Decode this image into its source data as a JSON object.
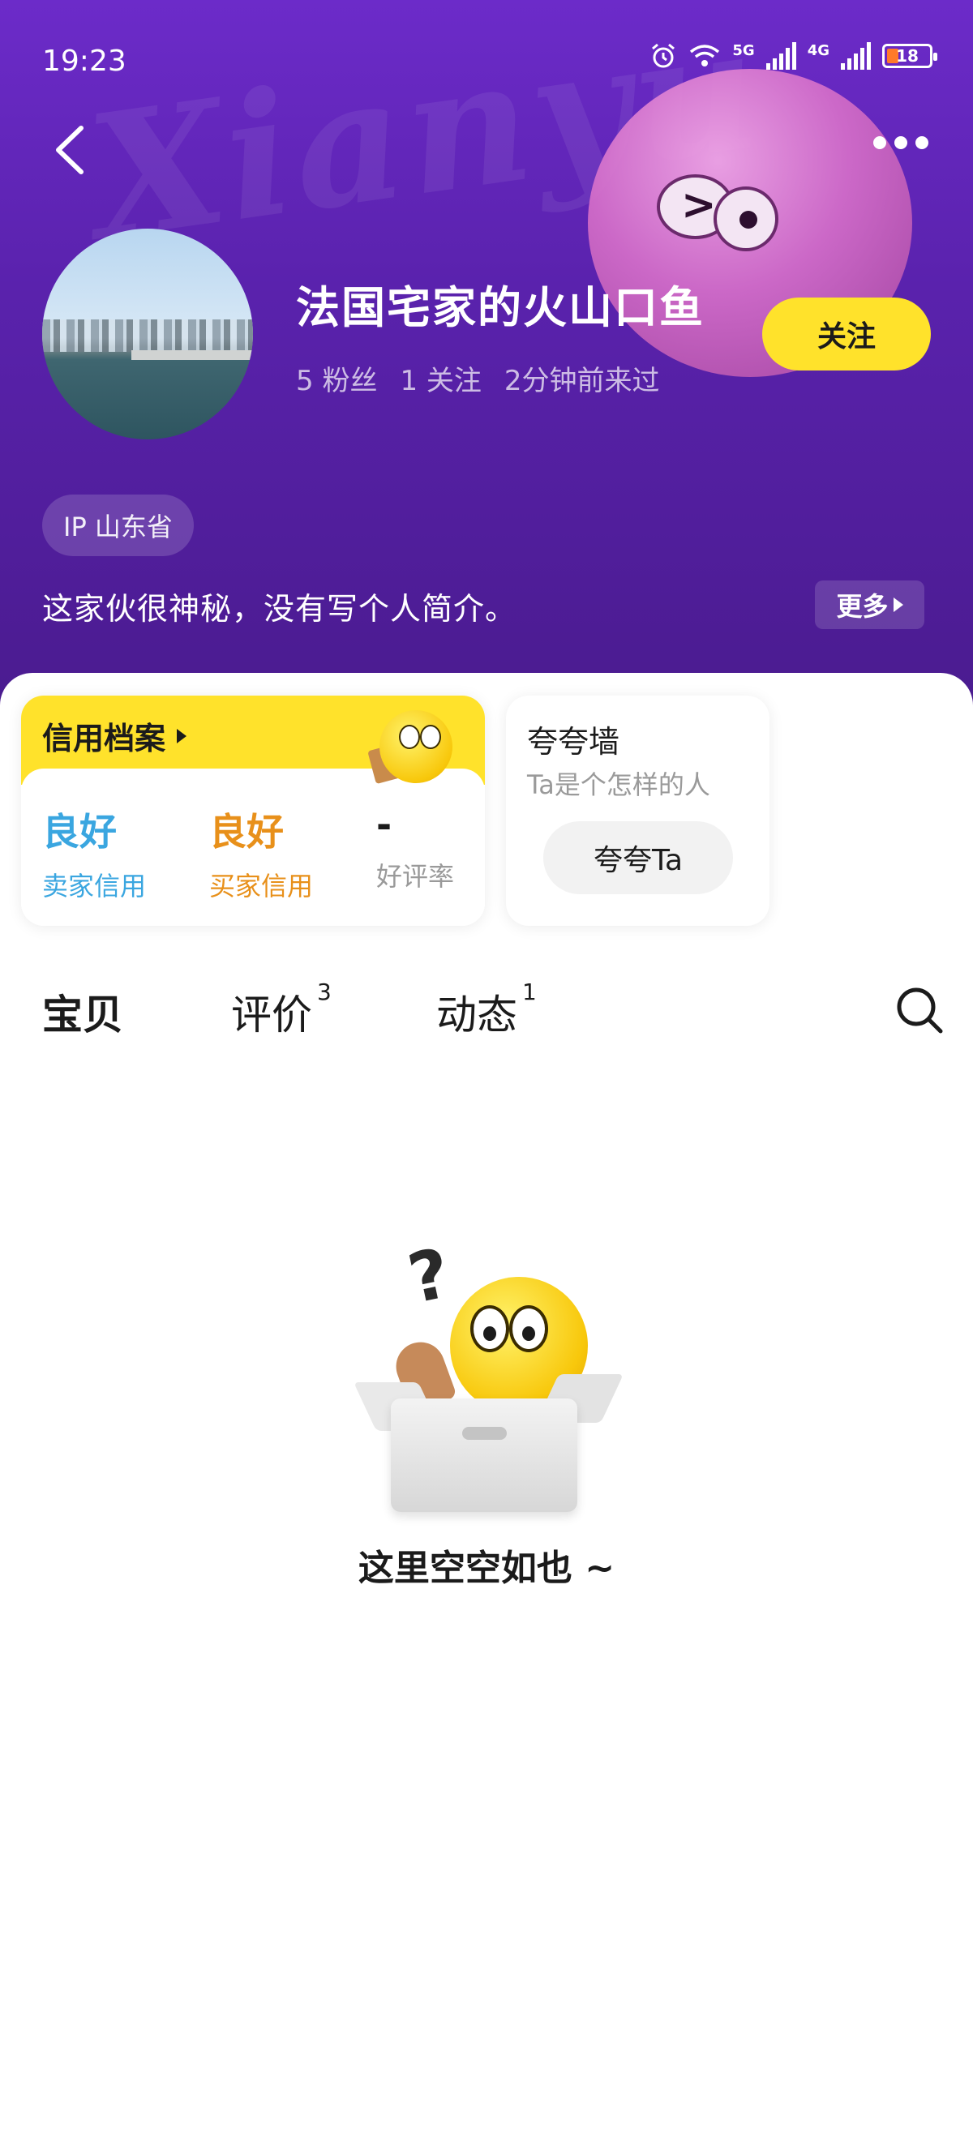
{
  "status_bar": {
    "time": "19:23",
    "net1": "5G",
    "net2": "4G",
    "battery": "18"
  },
  "header": {
    "watermark": "Xianyu",
    "username": "法国宅家的火山口鱼",
    "stats": {
      "fans": "5 粉丝",
      "following": "1 关注",
      "last_seen": "2分钟前来过"
    },
    "follow_label": "关注",
    "ip_label": "IP 山东省",
    "bio": "这家伙很神秘，没有写个人简介。",
    "more_label": "更多",
    "colors": {
      "bg": "#5a22ad",
      "accent": "#ffe22b"
    }
  },
  "credit": {
    "title": "信用档案",
    "items": [
      {
        "value": "良好",
        "label": "卖家信用",
        "color": "#3aa6e0"
      },
      {
        "value": "良好",
        "label": "买家信用",
        "color": "#e8901a"
      },
      {
        "value": "-",
        "label": "好评率",
        "color": "#1b1b1b"
      }
    ]
  },
  "praise": {
    "title": "夸夸墙",
    "subtitle": "Ta是个怎样的人",
    "button": "夸夸Ta"
  },
  "tabs": [
    {
      "label": "宝贝",
      "count": "",
      "active": true
    },
    {
      "label": "评价",
      "count": "3",
      "active": false
    },
    {
      "label": "动态",
      "count": "1",
      "active": false
    }
  ],
  "icons": {
    "back": "back-arrow-icon",
    "more": "more-dots-icon",
    "search": "search-icon",
    "alarm": "alarm-icon",
    "wifi": "wifi-icon"
  },
  "empty_state": {
    "message": "这里空空如也 ~"
  }
}
